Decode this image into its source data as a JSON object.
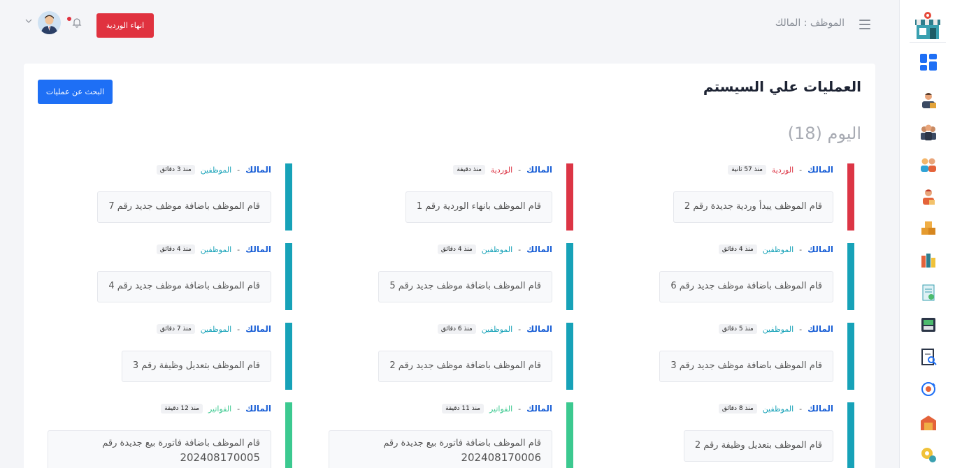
{
  "header": {
    "employee_label": "الموظف : المالك",
    "end_shift_label": "انهاء الوردية"
  },
  "sidebar": {
    "items": [
      {
        "icon": "dashboard-icon"
      },
      {
        "icon": "employee-icon"
      },
      {
        "icon": "employees-group-icon"
      },
      {
        "icon": "customers-icon"
      },
      {
        "icon": "supplier-icon"
      },
      {
        "icon": "products-box-icon"
      },
      {
        "icon": "categories-icon"
      },
      {
        "icon": "invoice-icon"
      },
      {
        "icon": "cashier-icon"
      },
      {
        "icon": "reports-icon"
      },
      {
        "icon": "currency-exchange-icon"
      },
      {
        "icon": "warehouse-icon"
      },
      {
        "icon": "settings-icon"
      }
    ]
  },
  "main": {
    "title": "العمليات علي السيستم",
    "search_button": "البحث عن عمليات",
    "day_heading": "اليوم (18)"
  },
  "colors": {
    "shift": "#dc3545",
    "employees": "#17a2b8",
    "invoices": "#3cc990"
  },
  "entries": [
    {
      "user": "المالك",
      "category": "الوردية",
      "time": "منذ 57 ثانية",
      "message": "قام الموظف يبدأ وردية جديدة رقم 2",
      "type": "shift"
    },
    {
      "user": "المالك",
      "category": "الوردية",
      "time": "منذ دقيقة",
      "message": "قام الموظف بانهاء الوردية رقم 1",
      "type": "shift"
    },
    {
      "user": "المالك",
      "category": "الموظفين",
      "time": "منذ 3 دقائق",
      "message": "قام الموظف باضافة موظف جديد رقم 7",
      "type": "employees"
    },
    {
      "user": "المالك",
      "category": "الموظفين",
      "time": "منذ 4 دقائق",
      "message": "قام الموظف باضافة موظف جديد رقم 6",
      "type": "employees"
    },
    {
      "user": "المالك",
      "category": "الموظفين",
      "time": "منذ 4 دقائق",
      "message": "قام الموظف باضافة موظف جديد رقم 5",
      "type": "employees"
    },
    {
      "user": "المالك",
      "category": "الموظفين",
      "time": "منذ 4 دقائق",
      "message": "قام الموظف باضافة موظف جديد رقم 4",
      "type": "employees"
    },
    {
      "user": "المالك",
      "category": "الموظفين",
      "time": "منذ 5 دقائق",
      "message": "قام الموظف باضافة موظف جديد رقم 3",
      "type": "employees"
    },
    {
      "user": "المالك",
      "category": "الموظفين",
      "time": "منذ 6 دقائق",
      "message": "قام الموظف باضافة موظف جديد رقم 2",
      "type": "employees"
    },
    {
      "user": "المالك",
      "category": "الموظفين",
      "time": "منذ 7 دقائق",
      "message": "قام الموظف بتعديل وظيفة رقم 3",
      "type": "employees"
    },
    {
      "user": "المالك",
      "category": "الموظفين",
      "time": "منذ 8 دقائق",
      "message": "قام الموظف بتعديل وظيفة رقم 2",
      "type": "employees"
    },
    {
      "user": "المالك",
      "category": "الفواتير",
      "time": "منذ 11 دقيقة",
      "message": "قام الموظف باضافة فاتورة بيع جديدة رقم",
      "number": "202408170006",
      "type": "invoices"
    },
    {
      "user": "المالك",
      "category": "الفواتير",
      "time": "منذ 12 دقيقة",
      "message": "قام الموظف باضافة فاتورة بيع جديدة رقم",
      "number": "202408170005",
      "type": "invoices"
    }
  ]
}
